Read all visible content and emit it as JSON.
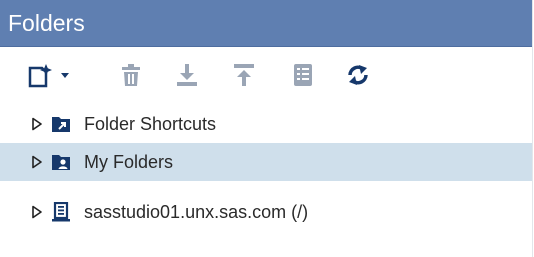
{
  "panel": {
    "title": "Folders"
  },
  "toolbar": {
    "buttons": [
      {
        "icon": "new-item-icon",
        "has_dropdown": true,
        "enabled": true
      },
      {
        "icon": "delete-icon",
        "enabled": false
      },
      {
        "icon": "download-icon",
        "enabled": false
      },
      {
        "icon": "upload-icon",
        "enabled": false
      },
      {
        "icon": "properties-icon",
        "enabled": false
      },
      {
        "icon": "refresh-icon",
        "enabled": true
      }
    ]
  },
  "tree": {
    "nodes": [
      {
        "label": "Folder Shortcuts",
        "icon": "shortcut-folder-icon",
        "selected": false
      },
      {
        "label": "My Folders",
        "icon": "user-folder-icon",
        "selected": true
      },
      {
        "label": "sasstudio01.unx.sas.com (/)",
        "icon": "server-icon",
        "selected": false
      }
    ]
  },
  "colors": {
    "titlebar": "#5f7fb1",
    "accent_dark": "#16386b",
    "disabled_icon": "#9aa5b5",
    "selected_row": "#cfdfeb"
  }
}
